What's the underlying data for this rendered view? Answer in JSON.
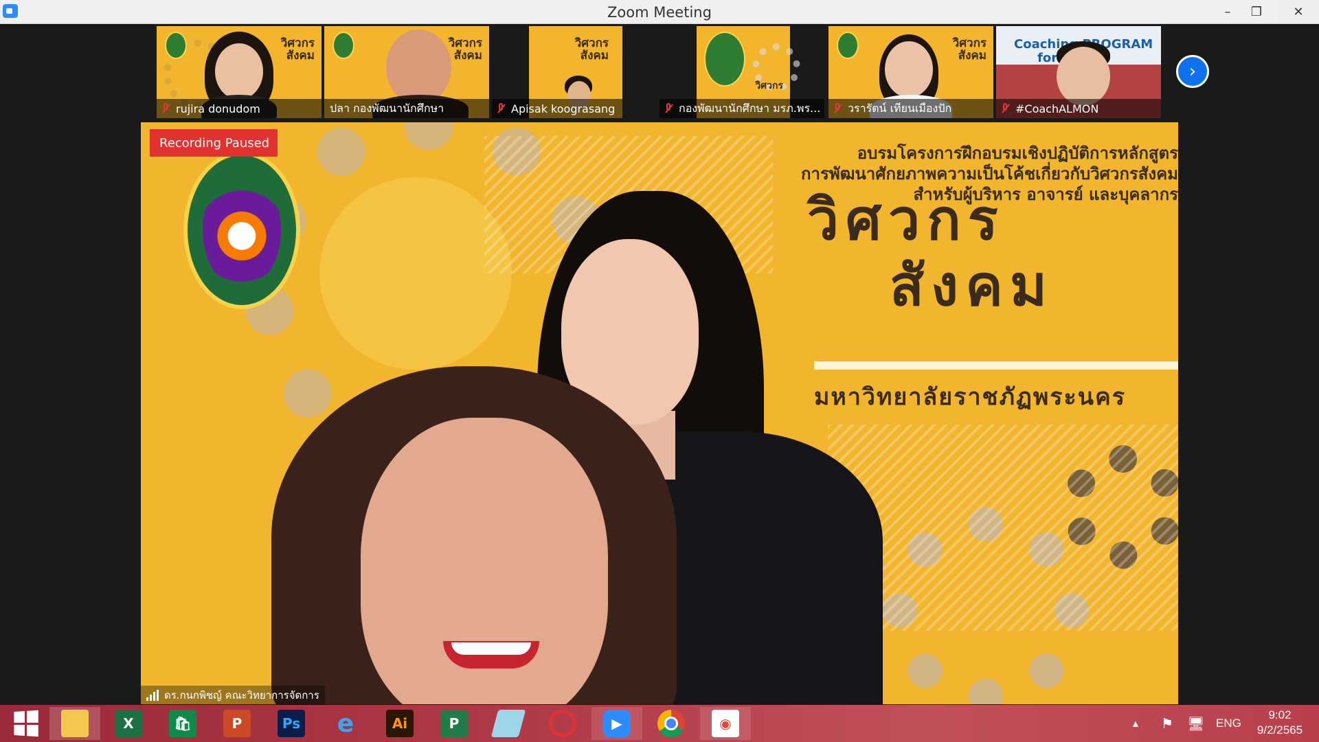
{
  "window": {
    "title": "Zoom Meeting",
    "minimize": "–",
    "maximize": "❐",
    "close": "✕"
  },
  "participants": [
    {
      "name": "rujira donudom",
      "muted": true
    },
    {
      "name": "ปลา กองพัฒนานักศึกษา",
      "muted": false
    },
    {
      "name": "Apisak koograsang",
      "muted": true
    },
    {
      "name": "กองพัฒนานักศึกษา มรภ.พร...",
      "muted": true
    },
    {
      "name": "วรารัตน์ เทียนเมืองปัก",
      "muted": true
    },
    {
      "name": "#CoachALMON",
      "muted": true
    }
  ],
  "thumb_text": {
    "slide_title_line1": "วิศวกร",
    "slide_title_line2": "สังคม",
    "coaching": "Coaching PROGRAM",
    "coaching2": "for ...er"
  },
  "next_page_icon": "chevron-right-icon",
  "recording_status": "Recording Paused",
  "slide": {
    "line1": "อบรมโครงการฝึกอบรมเชิงปฏิบัติการหลักสูตร",
    "line2": "การพัฒนาศักยภาพความเป็นโค้ชเกี่ยวกับวิศวกรสังคม",
    "line3": "สำหรับผู้บริหาร อาจารย์ และบุคลากร",
    "title1": "วิศวกร",
    "title2": "สังคม",
    "university": "มหาวิทยาลัยราชภัฏพระนคร"
  },
  "active_speaker": "ดร.กนกพิชญ์ คณะวิทยาการจัดการ",
  "taskbar": {
    "apps": [
      "windows-start",
      "file-explorer",
      "excel",
      "publisher",
      "powerpoint",
      "photoshop",
      "internet-explorer",
      "illustrator",
      "project",
      "notepad",
      "photoscape",
      "zoom",
      "chrome",
      "photo-app"
    ],
    "excel_label": "X",
    "ps_label": "Ps",
    "ai_label": "Ai",
    "pp_label": "P",
    "proj_label": "P",
    "language": "ENG",
    "time": "9:02",
    "date": "9/2/2565"
  },
  "colors": {
    "slide_bg": "#f2b52e",
    "recording_bg": "#e0322e",
    "zoom_blue": "#0e72ed"
  }
}
